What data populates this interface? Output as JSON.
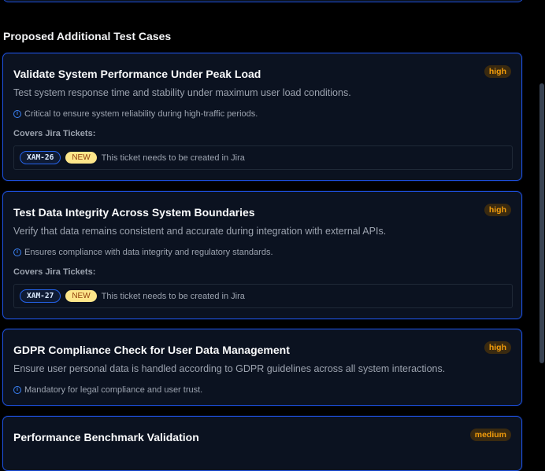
{
  "section": {
    "title": "Proposed Additional Test Cases"
  },
  "labels": {
    "covers": "Covers Jira Tickets:"
  },
  "cards": [
    {
      "title": "Validate System Performance Under Peak Load",
      "priority": "high",
      "description": "Test system response time and stability under maximum user load conditions.",
      "note": "Critical to ensure system reliability during high-traffic periods.",
      "ticket": {
        "id": "XAM-26",
        "badge": "NEW",
        "text": "This ticket needs to be created in Jira"
      }
    },
    {
      "title": "Test Data Integrity Across System Boundaries",
      "priority": "high",
      "description": "Verify that data remains consistent and accurate during integration with external APIs.",
      "note": "Ensures compliance with data integrity and regulatory standards.",
      "ticket": {
        "id": "XAM-27",
        "badge": "NEW",
        "text": "This ticket needs to be created in Jira"
      }
    },
    {
      "title": "GDPR Compliance Check for User Data Management",
      "priority": "high",
      "description": "Ensure user personal data is handled according to GDPR guidelines across all system interactions.",
      "note": "Mandatory for legal compliance and user trust."
    },
    {
      "title": "Performance Benchmark Validation",
      "priority": "medium"
    }
  ],
  "colors": {
    "accent": "#1d4ed8",
    "priority_text": "#f59e0b",
    "new_badge": "#fde68a"
  },
  "icons": {
    "note": "info-icon"
  }
}
